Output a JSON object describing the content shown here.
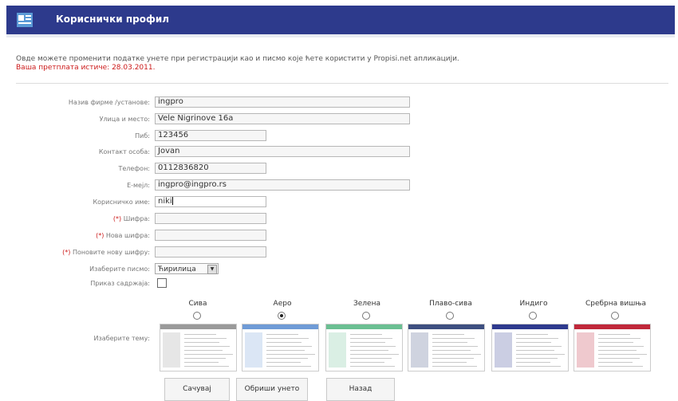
{
  "header": {
    "title": "Кориснички профил",
    "icon": "profile-app-icon",
    "bg": "#2d3a8c"
  },
  "intro": {
    "text": "Овде можете променити податке унете при регистрацији као и писмо које ћете користити у Propisi.net апликацији.",
    "expiry": "Ваша претплата истиче: 28.03.2011."
  },
  "form": {
    "required_mark": "(*)",
    "company": {
      "label": "Назив фирме /установе:",
      "value": "ingpro"
    },
    "address": {
      "label": "Улица и место:",
      "value": "Vele Nigrinove 16a"
    },
    "pib": {
      "label": "Пиб:",
      "value": "123456"
    },
    "contact": {
      "label": "Контакт особа:",
      "value": "Jovan"
    },
    "phone": {
      "label": "Телефон:",
      "value": "0112836820"
    },
    "email": {
      "label": "E-мејл:",
      "value": "ingpro@ingpro.rs"
    },
    "username": {
      "label": "Корисничко име:",
      "value": "niki"
    },
    "password": {
      "label": "Шифра:",
      "value": ""
    },
    "new_password": {
      "label": "Нова шифра:",
      "value": ""
    },
    "repeat_password": {
      "label": "Поновите нову шифру:",
      "value": ""
    },
    "script": {
      "label": "Изаберите писмо:",
      "selected": "Ћирилица"
    },
    "show_contents": {
      "label": "Приказ садржаја:",
      "checked": false
    },
    "theme": {
      "label": "Изаберите тему:",
      "options": [
        {
          "name": "Сива",
          "selected": false,
          "color": "#9a9a9a"
        },
        {
          "name": "Аеро",
          "selected": true,
          "color": "#6f9bd6"
        },
        {
          "name": "Зелена",
          "selected": false,
          "color": "#6bbf92"
        },
        {
          "name": "Плаво-сива",
          "selected": false,
          "color": "#3e4f80"
        },
        {
          "name": "Индиго",
          "selected": false,
          "color": "#2e3a8e"
        },
        {
          "name": "Сребрна вишња",
          "selected": false,
          "color": "#c0283a"
        }
      ]
    }
  },
  "buttons": {
    "save": "Сачувај",
    "clear": "Обриши унето",
    "back": "Назад"
  }
}
